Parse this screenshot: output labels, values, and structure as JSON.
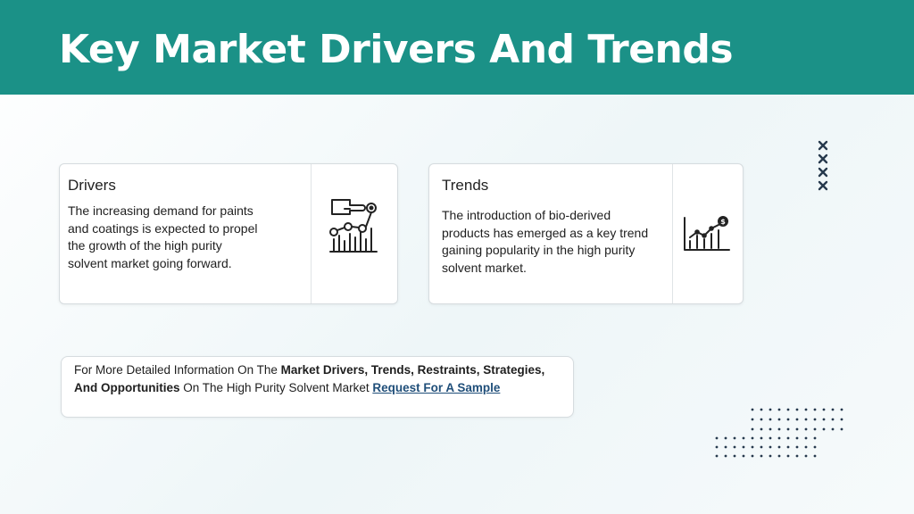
{
  "header": {
    "title": "Key Market Drivers And Trends"
  },
  "cards": [
    {
      "title": "Drivers",
      "text": "The increasing demand for paints and coatings is expected to propel the growth of the high purity solvent market going forward.",
      "icon": "factory-growth-icon"
    },
    {
      "title": "Trends",
      "text": "The introduction of bio-derived products has emerged as a key trend gaining popularity in the high purity solvent market.",
      "icon": "growth-chart-dollar-icon"
    }
  ],
  "info": {
    "prefix": "For More Detailed Information On The ",
    "bold1": "Market Drivers, Trends, Restraints, Strategies, And Opportunities",
    "middle": " On The High Purity Solvent Market ",
    "link": "Request For A Sample"
  },
  "colors": {
    "header": "#1b9187",
    "link": "#1f4e79",
    "accent_dark": "#26394d"
  }
}
